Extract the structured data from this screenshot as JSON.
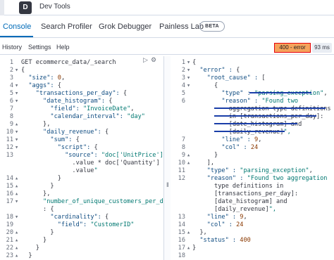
{
  "app": {
    "logo_letter": "D",
    "title": "Dev Tools"
  },
  "tabs": [
    {
      "label": "Console"
    },
    {
      "label": "Search Profiler"
    },
    {
      "label": "Grok Debugger"
    },
    {
      "label": "Painless Lab"
    }
  ],
  "beta_label": "BETA",
  "toolbar": {
    "history": "History",
    "settings": "Settings",
    "help": "Help"
  },
  "status": {
    "code": "400 - error",
    "time": "93 ms"
  },
  "request": {
    "lines": [
      {
        "n": "1",
        "f": "",
        "code": "GET ecommerce_data/_search"
      },
      {
        "n": "2",
        "f": "▾",
        "code": "{"
      },
      {
        "n": "3",
        "f": "",
        "code": "  \"size\": 0,"
      },
      {
        "n": "4",
        "f": "▾",
        "code": "  \"aggs\": {"
      },
      {
        "n": "5",
        "f": "▾",
        "code": "    \"transactions_per_day\": {"
      },
      {
        "n": "6",
        "f": "▾",
        "code": "      \"date_histogram\": {"
      },
      {
        "n": "7",
        "f": "",
        "code": "        \"field\": \"InvoiceDate\","
      },
      {
        "n": "8",
        "f": "",
        "code": "        \"calendar_interval\": \"day\""
      },
      {
        "n": "9",
        "f": "▴",
        "code": "      },"
      },
      {
        "n": "10",
        "f": "▾",
        "code": "      \"daily_revenue\": {"
      },
      {
        "n": "11",
        "f": "▾",
        "code": "        \"sum\": {"
      },
      {
        "n": "12",
        "f": "▾",
        "code": "          \"script\": {"
      },
      {
        "n": "13",
        "f": "",
        "code": "            \"source\": \"doc['UnitPrice']"
      },
      {
        "n": "",
        "f": "",
        "code": "              .value * doc['Quantity']"
      },
      {
        "n": "",
        "f": "",
        "code": "              .value\""
      },
      {
        "n": "14",
        "f": "▴",
        "code": "          }"
      },
      {
        "n": "15",
        "f": "▴",
        "code": "        }"
      },
      {
        "n": "16",
        "f": "▴",
        "code": "      },"
      },
      {
        "n": "17",
        "f": "▾",
        "code": "      \"number_of_unique_customers_per_day\""
      },
      {
        "n": "",
        "f": "",
        "code": "      : {"
      },
      {
        "n": "18",
        "f": "▾",
        "code": "        \"cardinality\": {"
      },
      {
        "n": "19",
        "f": "",
        "code": "          \"field\": \"CustomerID\""
      },
      {
        "n": "20",
        "f": "▴",
        "code": "        }"
      },
      {
        "n": "21",
        "f": "▴",
        "code": "      }"
      },
      {
        "n": "22",
        "f": "▴",
        "code": "    }"
      },
      {
        "n": "23",
        "f": "▴",
        "code": "  }"
      },
      {
        "n": "24",
        "f": "▴",
        "code": "}"
      }
    ]
  },
  "response": {
    "lines": [
      {
        "n": "1",
        "f": "▾",
        "code": "{"
      },
      {
        "n": "2",
        "f": "▾",
        "code": "  \"error\" : {"
      },
      {
        "n": "3",
        "f": "▾",
        "code": "    \"root_cause\" : ["
      },
      {
        "n": "4",
        "f": "▾",
        "code": "      {"
      },
      {
        "n": "5",
        "f": "",
        "code": "        \"type\" : \"parsing_exception\","
      },
      {
        "n": "6",
        "f": "",
        "code": "        \"reason\" : \"Found two"
      },
      {
        "n": "",
        "f": "",
        "code": "          aggregation type definitions"
      },
      {
        "n": "",
        "f": "",
        "code": "          in [transactions_per_day]:"
      },
      {
        "n": "",
        "f": "",
        "code": "          [date_histogram] and"
      },
      {
        "n": "",
        "f": "",
        "code": "          [daily_revenue]\","
      },
      {
        "n": "7",
        "f": "",
        "code": "        \"line\" : 9,"
      },
      {
        "n": "8",
        "f": "",
        "code": "        \"col\" : 24"
      },
      {
        "n": "9",
        "f": "▴",
        "code": "      }"
      },
      {
        "n": "10",
        "f": "▴",
        "code": "    ],"
      },
      {
        "n": "11",
        "f": "",
        "code": "    \"type\" : \"parsing_exception\","
      },
      {
        "n": "12",
        "f": "",
        "code": "    \"reason\" : \"Found two aggregation"
      },
      {
        "n": "",
        "f": "",
        "code": "      type definitions in"
      },
      {
        "n": "",
        "f": "",
        "code": "      [transactions_per_day]:"
      },
      {
        "n": "",
        "f": "",
        "code": "      [date_histogram] and"
      },
      {
        "n": "",
        "f": "",
        "code": "      [daily_revenue]\","
      },
      {
        "n": "13",
        "f": "",
        "code": "    \"line\" : 9,"
      },
      {
        "n": "14",
        "f": "",
        "code": "    \"col\" : 24"
      },
      {
        "n": "15",
        "f": "▴",
        "code": "  },"
      },
      {
        "n": "16",
        "f": "",
        "code": "  \"status\" : 400"
      },
      {
        "n": "17",
        "f": "▴",
        "code": "}"
      },
      {
        "n": "18",
        "f": "",
        "code": ""
      }
    ]
  },
  "colors": {
    "accent": "#006bb8",
    "error_badge": "#f5a35c",
    "error_border": "#e7000b",
    "annotation": "#1a3ea8"
  }
}
